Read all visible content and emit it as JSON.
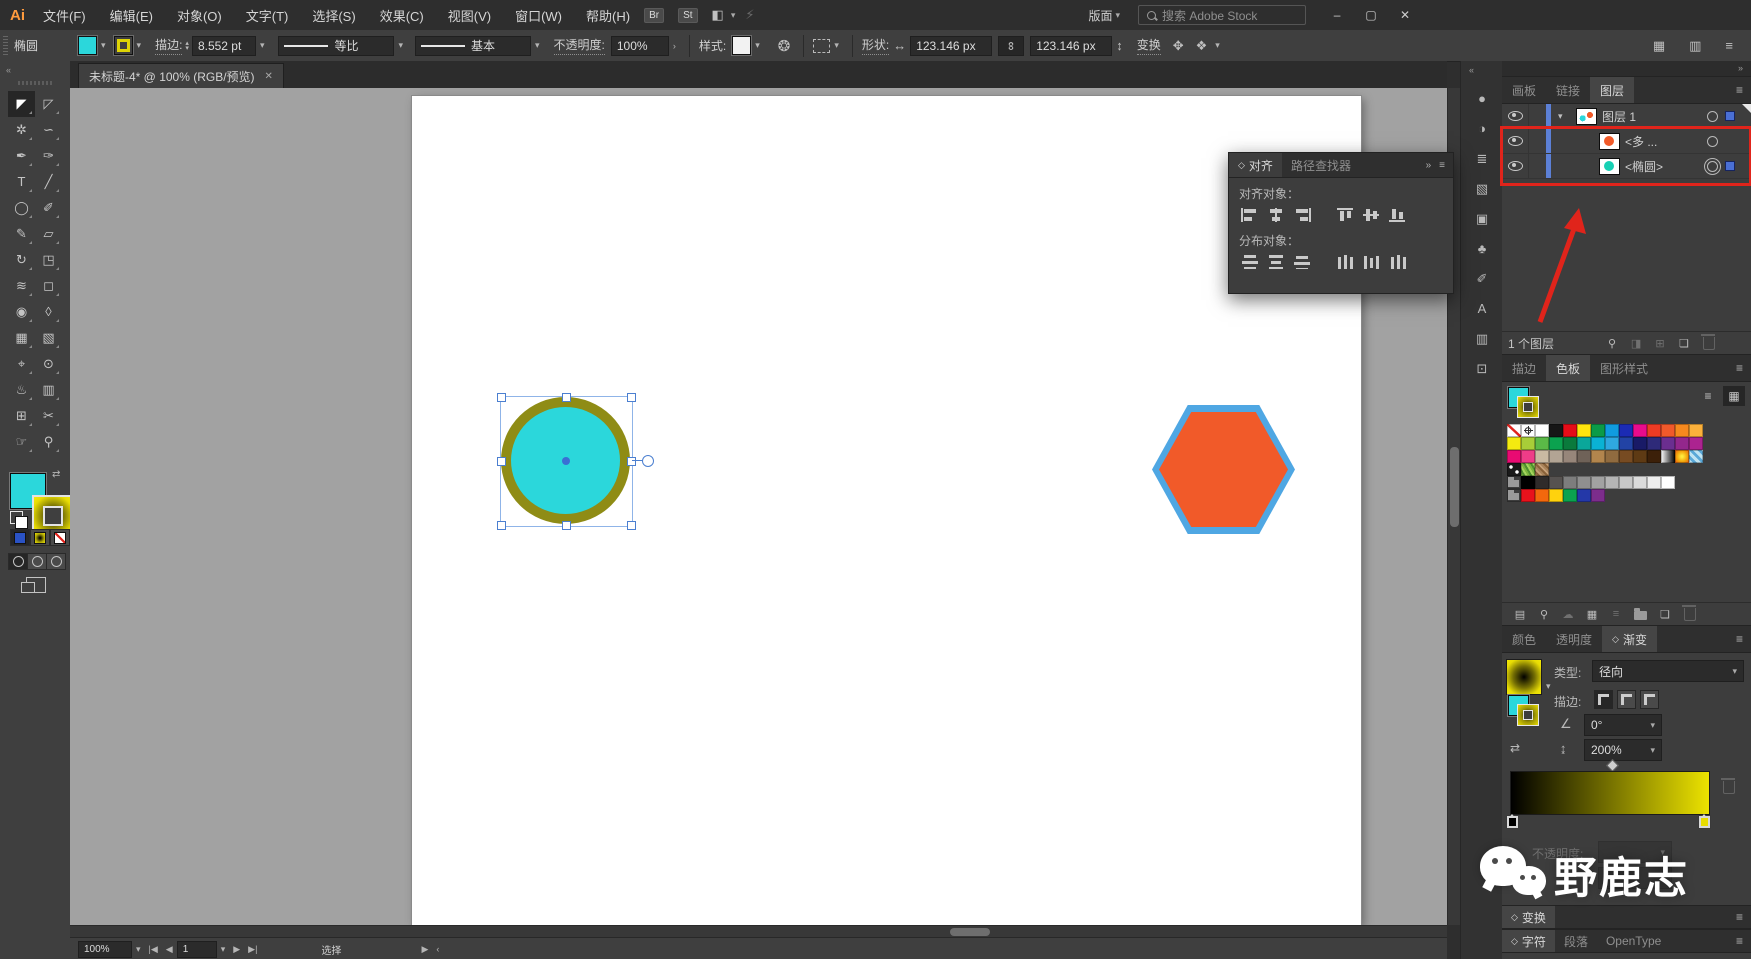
{
  "menu_bar": {
    "logo": "Ai",
    "items": [
      "文件(F)",
      "编辑(E)",
      "对象(O)",
      "文字(T)",
      "选择(S)",
      "效果(C)",
      "视图(V)",
      "窗口(W)",
      "帮助(H)"
    ],
    "bridge_button": "Br",
    "stock_button": "St",
    "layout_label": "版面",
    "search_placeholder": "搜索 Adobe Stock"
  },
  "window_controls": {
    "minimize": "–",
    "maximize": "▢",
    "close": "✕"
  },
  "options_bar": {
    "tool_label": "椭圆",
    "stroke_label": "描边:",
    "stroke_weight": "8.552 pt",
    "width_profile": "等比",
    "brush_definition": "基本",
    "opacity_label": "不透明度:",
    "opacity_value": "100%",
    "style_label": "样式:",
    "shape_label": "形状:",
    "shape_width": "123.146 px",
    "shape_height": "123.146 px",
    "transform_label": "变换"
  },
  "document_tab": {
    "title": "未标题-4* @ 100% (RGB/预览)",
    "close": "✕"
  },
  "toolbar": {
    "tools": [
      {
        "name": "selection",
        "glyph": "◤",
        "active": true
      },
      {
        "name": "direct-selection",
        "glyph": "◸",
        "active": false
      },
      {
        "name": "magic-wand",
        "glyph": "✲",
        "active": false
      },
      {
        "name": "lasso",
        "glyph": "∽",
        "active": false
      },
      {
        "name": "pen",
        "glyph": "✒",
        "active": false
      },
      {
        "name": "curvature",
        "glyph": "✑",
        "active": false
      },
      {
        "name": "type",
        "glyph": "T",
        "active": false
      },
      {
        "name": "line-segment",
        "glyph": "╱",
        "active": false
      },
      {
        "name": "ellipse",
        "glyph": "◯",
        "active": false
      },
      {
        "name": "paintbrush",
        "glyph": "✐",
        "active": false
      },
      {
        "name": "shaper",
        "glyph": "✎",
        "active": false
      },
      {
        "name": "eraser",
        "glyph": "▱",
        "active": false
      },
      {
        "name": "rotate",
        "glyph": "↻",
        "active": false
      },
      {
        "name": "scale",
        "glyph": "◳",
        "active": false
      },
      {
        "name": "width",
        "glyph": "≋",
        "active": false
      },
      {
        "name": "free-transform",
        "glyph": "◻",
        "active": false
      },
      {
        "name": "shape-builder",
        "glyph": "◉",
        "active": false
      },
      {
        "name": "perspective-grid",
        "glyph": "◊",
        "active": false
      },
      {
        "name": "mesh",
        "glyph": "▦",
        "active": false
      },
      {
        "name": "gradient",
        "glyph": "▧",
        "active": false
      },
      {
        "name": "eyedropper",
        "glyph": "⌖",
        "active": false
      },
      {
        "name": "blend",
        "glyph": "⊙",
        "active": false
      },
      {
        "name": "symbol-sprayer",
        "glyph": "♨",
        "active": false
      },
      {
        "name": "column-graph",
        "glyph": "▥",
        "active": false
      },
      {
        "name": "artboard",
        "glyph": "⊞",
        "active": false
      },
      {
        "name": "slice",
        "glyph": "✂",
        "active": false
      },
      {
        "name": "hand",
        "glyph": "☞",
        "active": false
      },
      {
        "name": "zoom",
        "glyph": "⚲",
        "active": false
      }
    ]
  },
  "dock_strip": {
    "icons": [
      {
        "name": "color-panel",
        "glyph": "●"
      },
      {
        "name": "color-guide",
        "glyph": "◑"
      },
      {
        "name": "stroke-panel",
        "glyph": "≣"
      },
      {
        "name": "gradient-panel",
        "glyph": "▧"
      },
      {
        "name": "transparency-panel",
        "glyph": "▣"
      },
      {
        "name": "symbols-panel",
        "glyph": "♣"
      },
      {
        "name": "brushes-panel",
        "glyph": "✐"
      },
      {
        "name": "character-styles-panel",
        "glyph": "A"
      },
      {
        "name": "graphic-styles-panel",
        "glyph": "▥"
      },
      {
        "name": "libraries-panel",
        "glyph": "⊡"
      }
    ]
  },
  "align_panel": {
    "tabs": [
      {
        "label": "对齐",
        "active": true
      },
      {
        "label": "路径查找器",
        "active": false
      }
    ],
    "align_objects_label": "对齐对象：",
    "distribute_objects_label": "分布对象："
  },
  "layers_panel": {
    "tabs": [
      "画板",
      "链接",
      "图层"
    ],
    "rows": [
      {
        "label": "图层 1"
      },
      {
        "label": "<多 ..."
      },
      {
        "label": "<椭圆>"
      }
    ],
    "footer": "1 个图层"
  },
  "swatches_panel": {
    "tabs": [
      "描边",
      "色板",
      "图形样式"
    ],
    "grid": [
      [
        "none",
        "reg",
        "#ffffff",
        "#161616",
        "#e60c18",
        "#ffe50d",
        "#0b9b48",
        "#109ce0",
        "#1b2bb4",
        "#ea0b8c",
        "#ee3b24",
        "#f0592b",
        "#f6891e",
        "#fbb03b"
      ],
      [
        "#f4ea10",
        "#a8ce38",
        "#5bb947",
        "#0ba24f",
        "#0a7a3c",
        "#0aa79a",
        "#0ab2d4",
        "#2fa8e0",
        "#2243a5",
        "#191a67",
        "#2e2a79",
        "#6b2e90",
        "#93278c",
        "#ac2390"
      ],
      [
        "#e90a72",
        "#ee3c88",
        "#c9b9a2",
        "#b2a494",
        "#97867a",
        "#6f6258",
        "#b2854d",
        "#906b3f",
        "#774b22",
        "#5e3a14",
        "#3c2009",
        "grad-bw",
        "grad-yo",
        "pattern-check"
      ],
      [
        "pattern-dots",
        "pattern-leaf",
        "pattern-wood"
      ],
      [
        "folder",
        "#000000",
        "#2f2b2a",
        "#565250",
        "#7d7d7d",
        "#8f8f8f",
        "#a2a2a2",
        "#b5b5b5",
        "#c8c8c8",
        "#dbdbdb",
        "#ededed",
        "#ffffff"
      ],
      [
        "folder",
        "#e8121c",
        "#f2680d",
        "#ffd20d",
        "#0ba24f",
        "#2438a8",
        "#7c2d8c"
      ]
    ]
  },
  "gradient_panel": {
    "tabs": [
      "颜色",
      "透明度",
      "渐变"
    ],
    "type_label": "类型:",
    "type_value": "径向",
    "stroke_label": "描边:",
    "angle_value": "0°",
    "aspect_value": "200%",
    "opacity_label": "不透明度:",
    "gradient_stops": [
      "#000000",
      "#ece300"
    ]
  },
  "transform_bar": {
    "label": "变换"
  },
  "type_bar": {
    "tabs": [
      "字符",
      "段落",
      "OpenType"
    ]
  },
  "status_bar": {
    "zoom": "100%",
    "page": "1",
    "tool_hint": "选择"
  },
  "watermark": {
    "text": "野鹿志"
  },
  "canvas_objects": {
    "circle": {
      "fill": "#2bd7db",
      "ring": "#8f8c15"
    },
    "hexagon": {
      "fill": "#f15a29",
      "stroke": "#4fa7e3"
    }
  },
  "colors": {
    "annotation_red": "#e0241b",
    "selection_blue": "#4b7fd0"
  },
  "icons": {
    "chevron": "▾",
    "up": "▴",
    "expand": "›",
    "dright": "»",
    "dleft": "«",
    "menu": "≡",
    "diamond": "◇",
    "swap": "⇄",
    "link": "∞",
    "warr": "↔",
    "harr": "↕",
    "angle": "∠",
    "aspect": "↨",
    "reverse": "⇄",
    "recolor": "❂",
    "fit": "✥",
    "more": "❖",
    "arrange": "▦",
    "workspace": "▥",
    "layout": "◧",
    "gpu": "⚡",
    "library": "▤",
    "locate": "⚲",
    "cloud": "☁",
    "kinds": "▦",
    "newitem": "❏",
    "mask": "◨",
    "sublayer": "⊞",
    "first": "|◀",
    "prev": "◀",
    "next": "▶",
    "last": "▶|",
    "play": "▶",
    "back": "‹"
  }
}
